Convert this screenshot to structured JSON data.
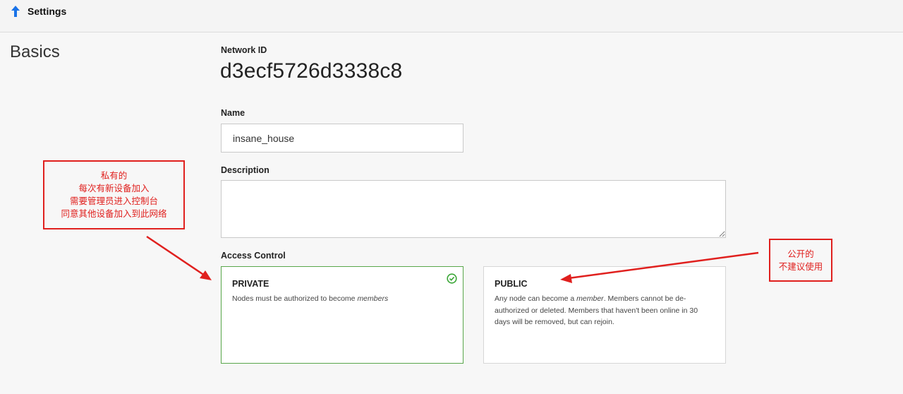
{
  "header": {
    "title": "Settings",
    "icon": "arrow-up-icon",
    "icon_color": "#1a73e8"
  },
  "basics": {
    "section_title": "Basics",
    "network_id_label": "Network ID",
    "network_id": "d3ecf5726d3338c8",
    "name_label": "Name",
    "name_value": "insane_house",
    "description_label": "Description",
    "description_value": "",
    "access_control_label": "Access Control"
  },
  "access_control": {
    "private": {
      "title": "PRIVATE",
      "desc_prefix": "Nodes must be authorized to become ",
      "desc_em": "members",
      "selected": true
    },
    "public": {
      "title": "PUBLIC",
      "desc_prefix": "Any node can become a ",
      "desc_em": "member",
      "desc_suffix": ". Members cannot be de-authorized or deleted. Members that haven't been online in 30 days will be removed, but can rejoin.",
      "selected": false
    }
  },
  "annotations": {
    "private_note": [
      "私有的",
      "每次有新设备加入",
      "需要管理员进入控制台",
      "同意其他设备加入到此网络"
    ],
    "public_note": [
      "公开的",
      "不建议使用"
    ],
    "color": "#e0201e"
  },
  "colors": {
    "selected_border": "#58a64a",
    "check": "#3aa636"
  }
}
